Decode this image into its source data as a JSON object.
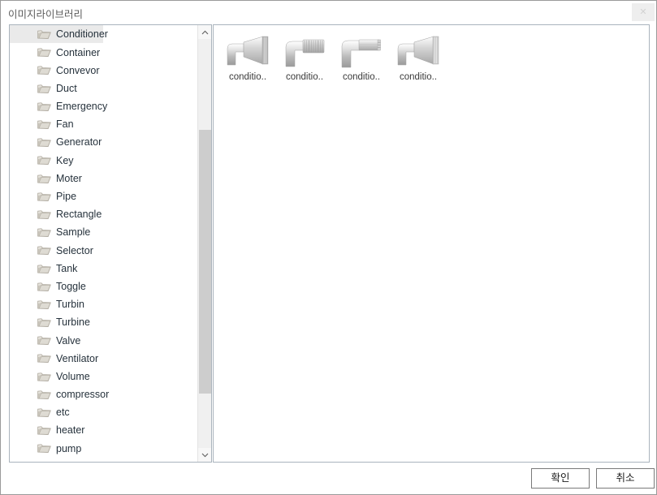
{
  "window": {
    "title": "이미지라이브러리",
    "close_label": "✕",
    "close_icon": "close-icon"
  },
  "category_list": {
    "selected": "Conditioner",
    "items": [
      {
        "label": "Conditioner",
        "icon": "folder-icon"
      },
      {
        "label": "Container",
        "icon": "folder-icon"
      },
      {
        "label": "Convevor",
        "icon": "folder-icon"
      },
      {
        "label": "Duct",
        "icon": "folder-icon"
      },
      {
        "label": "Emergency",
        "icon": "folder-icon"
      },
      {
        "label": "Fan",
        "icon": "folder-icon"
      },
      {
        "label": "Generator",
        "icon": "folder-icon"
      },
      {
        "label": "Key",
        "icon": "folder-icon"
      },
      {
        "label": "Moter",
        "icon": "folder-icon"
      },
      {
        "label": "Pipe",
        "icon": "folder-icon"
      },
      {
        "label": "Rectangle",
        "icon": "folder-icon"
      },
      {
        "label": "Sample",
        "icon": "folder-icon"
      },
      {
        "label": "Selector",
        "icon": "folder-icon"
      },
      {
        "label": "Tank",
        "icon": "folder-icon"
      },
      {
        "label": "Toggle",
        "icon": "folder-icon"
      },
      {
        "label": "Turbin",
        "icon": "folder-icon"
      },
      {
        "label": "Turbine",
        "icon": "folder-icon"
      },
      {
        "label": "Valve",
        "icon": "folder-icon"
      },
      {
        "label": "Ventilator",
        "icon": "folder-icon"
      },
      {
        "label": "Volume",
        "icon": "folder-icon"
      },
      {
        "label": "compressor",
        "icon": "folder-icon"
      },
      {
        "label": "etc",
        "icon": "folder-icon"
      },
      {
        "label": "heater",
        "icon": "folder-icon"
      },
      {
        "label": "pump",
        "icon": "folder-icon"
      }
    ],
    "scrollbar": {
      "up_arrow_icon": "chevron-up-icon",
      "down_arrow_icon": "chevron-down-icon"
    }
  },
  "thumbnails": {
    "items": [
      {
        "label": "conditio..",
        "shape": "elbow-cone"
      },
      {
        "label": "conditio..",
        "shape": "elbow-ribbed"
      },
      {
        "label": "conditio..",
        "shape": "elbow-flat"
      },
      {
        "label": "conditio..",
        "shape": "elbow-cone-light"
      }
    ]
  },
  "buttons": {
    "ok": "확인",
    "cancel": "취소"
  },
  "colors": {
    "selection": "#eaeaea",
    "panel_border": "#aab4bd",
    "scroll_thumb": "#cdcdcd",
    "text": "#26323c",
    "title_text": "#5b5b5b"
  }
}
